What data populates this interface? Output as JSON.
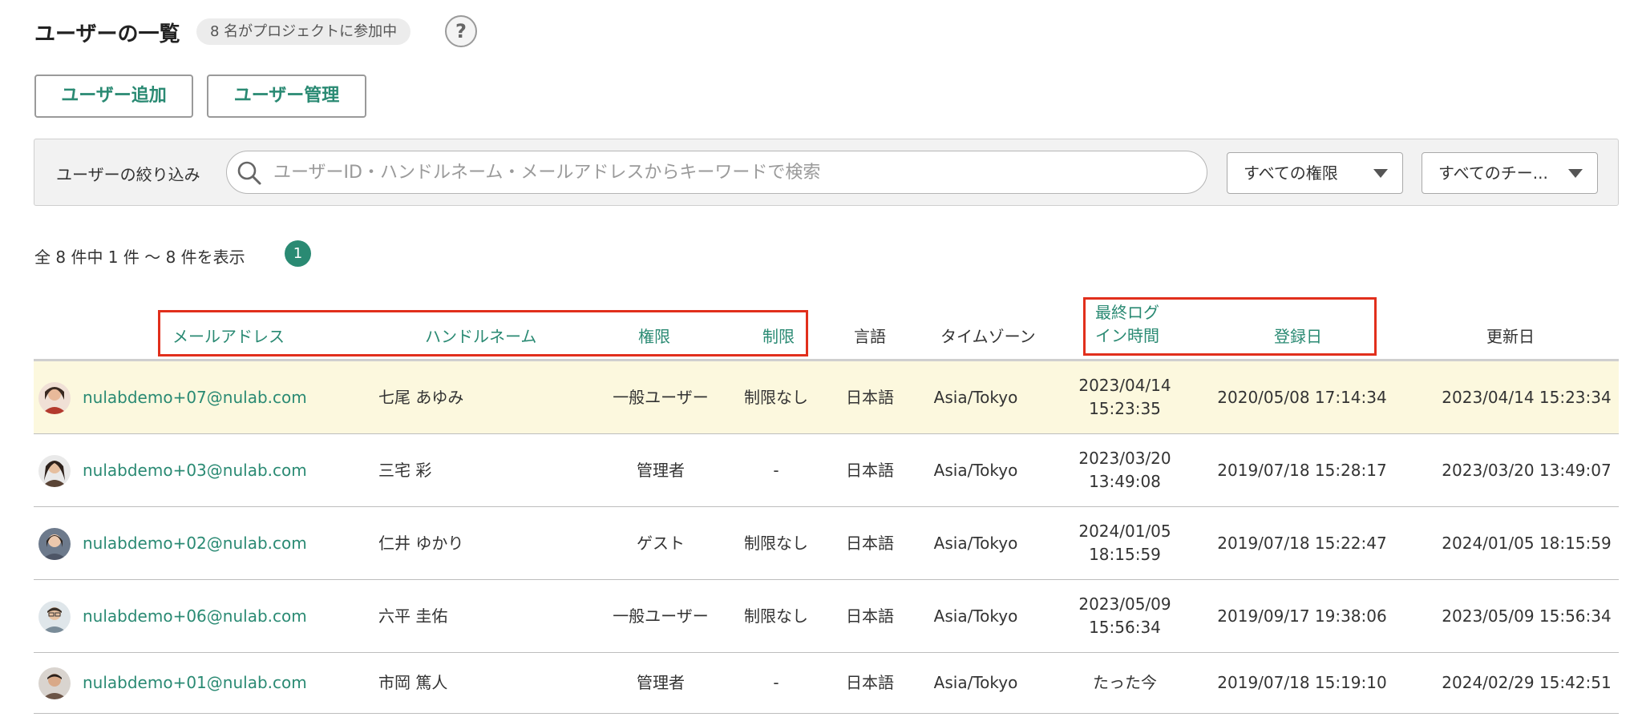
{
  "header": {
    "title": "ユーザーの一覧",
    "member_badge": "8 名がプロジェクトに参加中",
    "help_label": "?"
  },
  "actions": {
    "add_user": "ユーザー追加",
    "manage_users": "ユーザー管理"
  },
  "filter": {
    "label": "ユーザーの絞り込み",
    "search_placeholder": "ユーザーID・ハンドルネーム・メールアドレスからキーワードで検索",
    "role_select": "すべての権限",
    "team_select": "すべてのチー..."
  },
  "pagination": {
    "summary": "全 8 件中 1 件 〜 8 件を表示",
    "current_page": "1"
  },
  "table": {
    "headers": {
      "email": "メールアドレス",
      "handle": "ハンドルネーム",
      "role": "権限",
      "restriction": "制限",
      "language": "言語",
      "timezone": "タイムゾーン",
      "last_login_line1": "最終ログ",
      "last_login_line2": "イン時間",
      "registered": "登録日",
      "updated": "更新日"
    },
    "rows": [
      {
        "email": "nulabdemo+07@nulab.com",
        "handle": "七尾 あゆみ",
        "role": "一般ユーザー",
        "restriction": "制限なし",
        "language": "日本語",
        "timezone": "Asia/Tokyo",
        "last_login_date": "2023/04/14",
        "last_login_time": "15:23:35",
        "registered": "2020/05/08 17:14:34",
        "updated": "2023/04/14 15:23:34",
        "avatar_color": "#b33a2e"
      },
      {
        "email": "nulabdemo+03@nulab.com",
        "handle": "三宅 彩",
        "role": "管理者",
        "restriction": "-",
        "language": "日本語",
        "timezone": "Asia/Tokyo",
        "last_login_date": "2023/03/20",
        "last_login_time": "13:49:08",
        "registered": "2019/07/18 15:28:17",
        "updated": "2023/03/20 13:49:07",
        "avatar_color": "#5a4436"
      },
      {
        "email": "nulabdemo+02@nulab.com",
        "handle": "仁井 ゆかり",
        "role": "ゲスト",
        "restriction": "制限なし",
        "language": "日本語",
        "timezone": "Asia/Tokyo",
        "last_login_date": "2024/01/05",
        "last_login_time": "18:15:59",
        "registered": "2019/07/18 15:22:47",
        "updated": "2024/01/05 18:15:59",
        "avatar_color": "#4d5566"
      },
      {
        "email": "nulabdemo+06@nulab.com",
        "handle": "六平 圭佑",
        "role": "一般ユーザー",
        "restriction": "制限なし",
        "language": "日本語",
        "timezone": "Asia/Tokyo",
        "last_login_date": "2023/05/09",
        "last_login_time": "15:56:34",
        "registered": "2019/09/17 19:38:06",
        "updated": "2023/05/09 15:56:34",
        "avatar_color": "#7a8c99"
      },
      {
        "email": "nulabdemo+01@nulab.com",
        "handle": "市岡 篤人",
        "role": "管理者",
        "restriction": "-",
        "language": "日本語",
        "timezone": "Asia/Tokyo",
        "last_login_date": "たった今",
        "last_login_time": "",
        "registered": "2019/07/18 15:19:10",
        "updated": "2024/02/29 15:42:51",
        "avatar_color": "#6b5446"
      }
    ]
  },
  "colors": {
    "accent": "#2a8a73",
    "highlight_row": "#fcf8de",
    "annotation_box": "#e12f1c"
  }
}
